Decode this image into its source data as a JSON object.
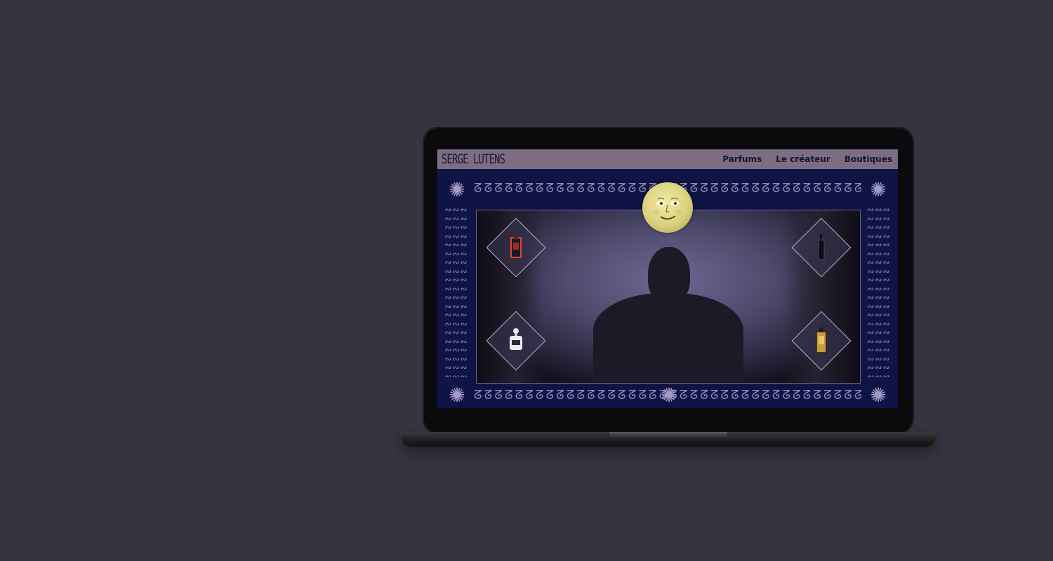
{
  "site": {
    "logo_text": "SERGE LUTENS",
    "nav": [
      {
        "label": "Parfums"
      },
      {
        "label": "Le créateur"
      },
      {
        "label": "Boutiques"
      }
    ]
  },
  "decor": {
    "sun_glyph": "✺",
    "pattern_horizontal": "ᘔᘔᘔᘔᘔᘔᘔᘔᘔᘔᘔᘔᘔᘔᘔᘔᘔᘔᘔᘔᘔᘔᘔᘔᘔᘔᘔᘔᘔᘔᘔᘔᘔᘔᘔᘔᘔᘔᘔᘔ",
    "pattern_vertical": "∾∾∾ ∾∾∾ ∾∾∾ ∾∾∾ ∾∾∾ ∾∾∾ ∾∾∾ ∾∾∾ ∾∾∾ ∾∾∾ ∾∾∾ ∾∾∾ ∾∾∾ ∾∾∾ ∾∾∾ ∾∾∾ ∾∾∾ ∾∾∾ ∾∾∾ ∾∾∾",
    "colors": {
      "page_bg": "#37333f",
      "header_bg": "#7c6d85",
      "screen_bg": "#101345",
      "moon": "#e4dc8c",
      "pattern": "#8f89b4"
    }
  },
  "products": [
    {
      "icon": "red-bottle-icon"
    },
    {
      "icon": "black-bottle-icon"
    },
    {
      "icon": "white-bottle-icon"
    },
    {
      "icon": "gold-bottle-icon"
    }
  ]
}
